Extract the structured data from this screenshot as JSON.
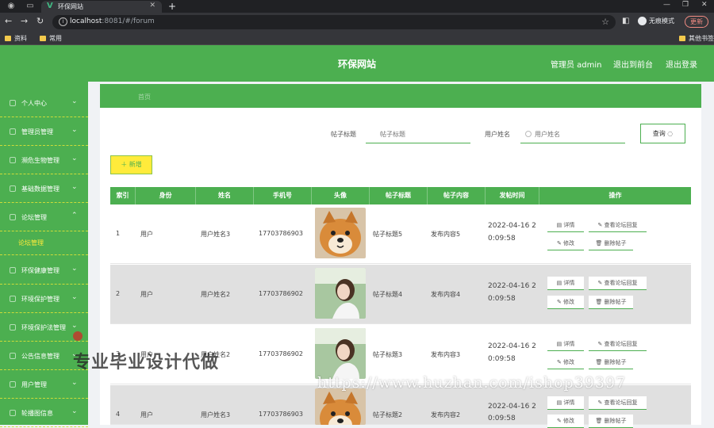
{
  "browser": {
    "tab_title": "环保网站",
    "url_host": "localhost",
    "url_rest": ":8081/#/forum",
    "profile_label": "无痕模式",
    "update_label": "更新",
    "bookmarks": [
      "资料",
      "常用"
    ],
    "bookmark_right": "其他书签"
  },
  "header": {
    "title": "环保网站",
    "user": "管理员 admin",
    "back_front": "退出到前台",
    "logout": "退出登录"
  },
  "sidebar": {
    "items": [
      {
        "label": "个人中心"
      },
      {
        "label": "管理员管理"
      },
      {
        "label": "濒危生物管理"
      },
      {
        "label": "基础数据管理"
      },
      {
        "label": "论坛管理"
      },
      {
        "label": "环保健康管理"
      },
      {
        "label": "环境保护管理"
      },
      {
        "label": "环境保护法管理"
      },
      {
        "label": "公告信息管理"
      },
      {
        "label": "用户管理"
      },
      {
        "label": "轮播图信息"
      }
    ],
    "sub_item": "论坛管理"
  },
  "breadcrumb": "首页",
  "search": {
    "title_label": "帖子标题",
    "title_placeholder": "帖子标题",
    "user_label": "用户姓名",
    "user_placeholder": "用户姓名",
    "query_label": "查询"
  },
  "add_label": "＋ 新增",
  "table": {
    "columns": [
      "索引",
      "身份",
      "姓名",
      "手机号",
      "头像",
      "帖子标题",
      "帖子内容",
      "发帖时间",
      "操作"
    ],
    "rows": [
      {
        "index": "1",
        "role": "用户",
        "name": "用户姓名3",
        "phone": "17703786903",
        "avatar": "dog-avatar",
        "title": "帖子标题5",
        "content": "发布内容5",
        "time1": "2022-04-16 2",
        "time2": "0:09:58"
      },
      {
        "index": "2",
        "role": "用户",
        "name": "用户姓名2",
        "phone": "17703786902",
        "avatar": "girl-avatar",
        "title": "帖子标题4",
        "content": "发布内容4",
        "time1": "2022-04-16 2",
        "time2": "0:09:58"
      },
      {
        "index": "3",
        "role": "用户",
        "name": "用户姓名2",
        "phone": "17703786902",
        "avatar": "girl-avatar",
        "title": "帖子标题3",
        "content": "发布内容3",
        "time1": "2022-04-16 2",
        "time2": "0:09:58"
      },
      {
        "index": "4",
        "role": "用户",
        "name": "用户姓名3",
        "phone": "17703786903",
        "avatar": "dog-avatar",
        "title": "帖子标题2",
        "content": "发布内容2",
        "time1": "2022-04-16 2",
        "time2": "0:09:58"
      }
    ],
    "actions": {
      "detail": "详情",
      "view_reply": "查看论坛回复",
      "edit": "修改",
      "delete": "删除帖子"
    }
  },
  "watermark": {
    "cn": "专业毕业设计代做",
    "url": "https://www.huzhan.com/ishop39397"
  },
  "colors": {
    "primary": "#4caf50",
    "accent": "#ffeb3b"
  }
}
